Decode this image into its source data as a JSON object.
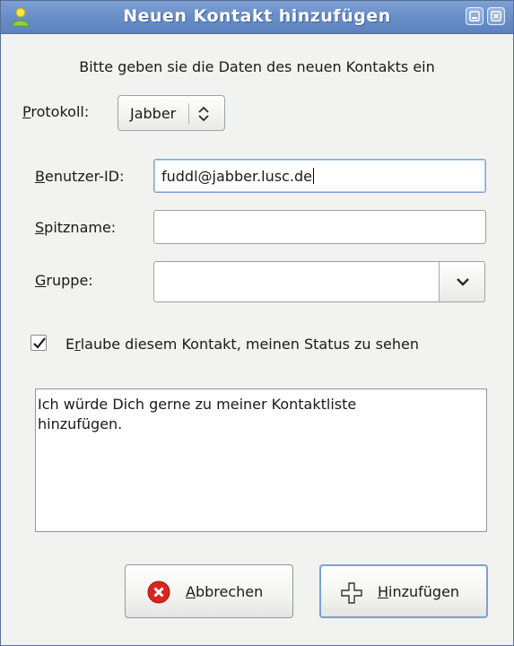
{
  "window": {
    "title": "Neuen Kontakt hinzufügen",
    "icons": {
      "app": "buddy-icon",
      "minimize": "minimize-icon",
      "close": "close-icon"
    }
  },
  "dialog": {
    "intro": "Bitte geben sie die Daten des neuen Kontakts ein",
    "protocol": {
      "label_mnemonic": "P",
      "label_rest": "rotokoll:",
      "value": "Jabber"
    },
    "user_id": {
      "label_mnemonic": "B",
      "label_rest": "enutzer-ID:",
      "value": "fuddl@jabber.lusc.de"
    },
    "nickname": {
      "label_mnemonic": "S",
      "label_rest": "pitzname:",
      "value": ""
    },
    "group": {
      "label_mnemonic": "G",
      "label_rest": "ruppe:",
      "value": ""
    },
    "allow_status": {
      "label_before": "E",
      "label_mnemonic": "r",
      "label_rest": "laube diesem Kontakt, meinen Status zu sehen",
      "checked": true
    },
    "message": "Ich würde Dich gerne zu meiner Kontaktliste hinzufügen."
  },
  "buttons": {
    "cancel": {
      "label_mnemonic": "A",
      "label_rest": "bbrechen",
      "icon": "cancel-icon"
    },
    "add": {
      "label_mnemonic": "H",
      "label_rest": "inzufügen",
      "icon": "add-icon"
    }
  },
  "colors": {
    "titlebar": "#6a8fc9",
    "focus_border": "#7fa2d8",
    "cancel_red": "#d9261c"
  }
}
